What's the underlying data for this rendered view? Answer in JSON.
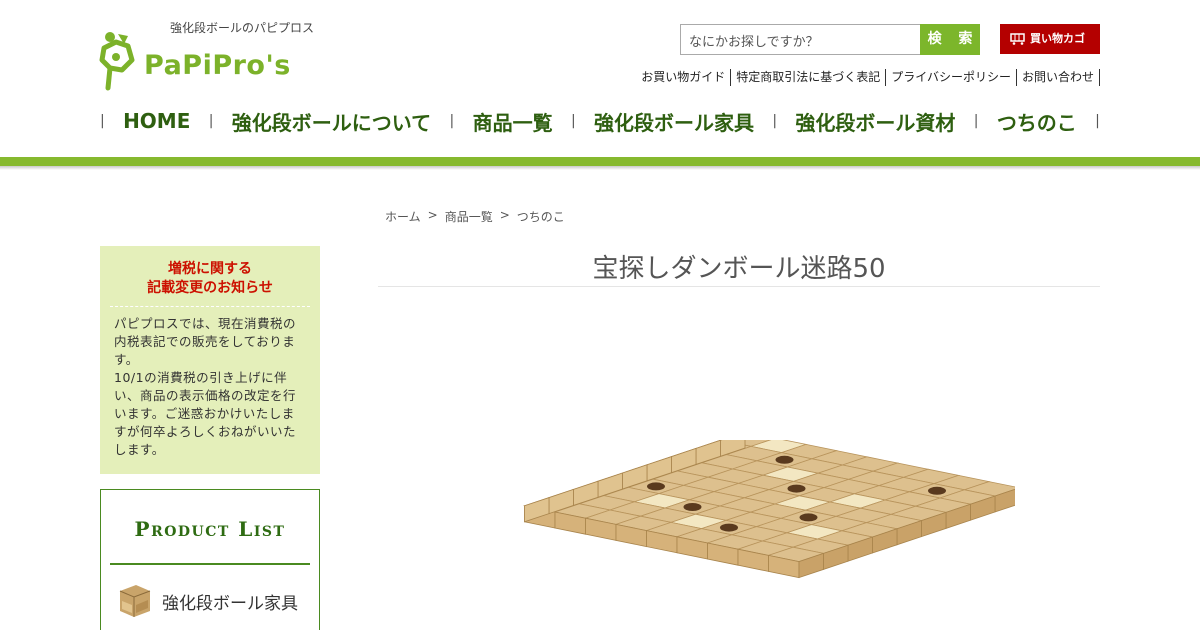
{
  "header": {
    "tagline": "強化段ボールのパピプロス",
    "logo_text": "PaPiPro's",
    "search": {
      "placeholder": "なにかお探しですか？",
      "button": "検 索"
    },
    "cart_label": "買い物カゴ",
    "subnav": [
      "お買い物ガイド",
      "特定商取引法に基づく表記",
      "プライバシーポリシー",
      "お問い合わせ"
    ],
    "mainnav": [
      "HOME",
      "強化段ボールについて",
      "商品一覧",
      "強化段ボール家具",
      "強化段ボール資材",
      "つちのこ"
    ]
  },
  "breadcrumb": [
    "ホーム",
    ">",
    "商品一覧",
    ">",
    "つちのこ"
  ],
  "notice": {
    "title_line1": "増税に関する",
    "title_line2": "記載変更のお知らせ",
    "body1": "パピプロスでは、現在消費税の内税表記での販売をしております。",
    "body2": "10/1の消費税の引き上げに伴い、商品の表示価格の改定を行います。ご迷惑おかけいたしますが何卒よろしくおねがいいたします。"
  },
  "product_list": {
    "title": "Product List",
    "items": [
      "強化段ボール家具"
    ]
  },
  "product": {
    "title": "宝探しダンボール迷路50"
  },
  "colors": {
    "brand_green": "#86b92e",
    "nav_green": "#2e5f10",
    "cart_red": "#b40000",
    "notice_bg": "#e4efba",
    "notice_red": "#cc1100"
  },
  "icons": [
    "logo-mark-icon",
    "cart-icon",
    "chair-thumbnail-icon"
  ]
}
